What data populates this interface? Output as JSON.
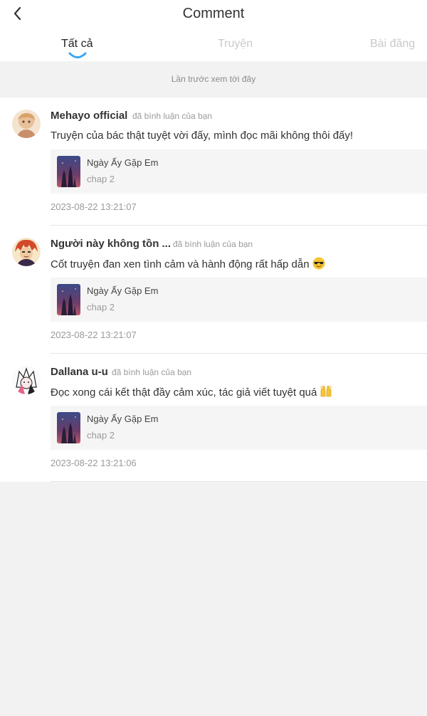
{
  "header": {
    "title": "Comment",
    "back_icon": "chevron-left-icon"
  },
  "tabs": [
    {
      "label": "Tất cả",
      "active": true
    },
    {
      "label": "Truyện",
      "active": false
    },
    {
      "label": "Bài đăng",
      "active": false
    }
  ],
  "banner": {
    "text": "Lần trước xem tới đây"
  },
  "comments": [
    {
      "username": "Mehayo official",
      "action": "đã bình luận của bạn",
      "text": "Truyện của bác thật tuyệt vời đấy, mình đọc mãi không thôi đấy!",
      "emoji": "",
      "ref_title": "Ngày Ấy Gặp Em",
      "ref_chap": "chap 2",
      "timestamp": "2023-08-22 13:21:07"
    },
    {
      "username": "Người này không tồn ...",
      "action": "đã bình luận của bạn",
      "text": "Cốt truyện đan xen tình cảm và hành động rất hấp dẫn",
      "emoji": "sunglasses-emoji",
      "ref_title": "Ngày Ấy Gặp Em",
      "ref_chap": "chap 2",
      "timestamp": "2023-08-22 13:21:07"
    },
    {
      "username": "Dallana u-u",
      "action": "đã bình luận của bạn",
      "text": "Đọc xong cái kết thật đầy cảm xúc, tác giả viết tuyệt quá",
      "emoji": "raised-hands-emoji",
      "ref_title": "Ngày Ấy Gặp Em",
      "ref_chap": "chap 2",
      "timestamp": "2023-08-22 13:21:06"
    }
  ],
  "colors": {
    "background": "#f2f2f2",
    "card": "#ffffff",
    "ref_card": "#f5f5f5",
    "tab_indicator": "#3aa5f5",
    "muted_text": "#9a9a9a"
  }
}
